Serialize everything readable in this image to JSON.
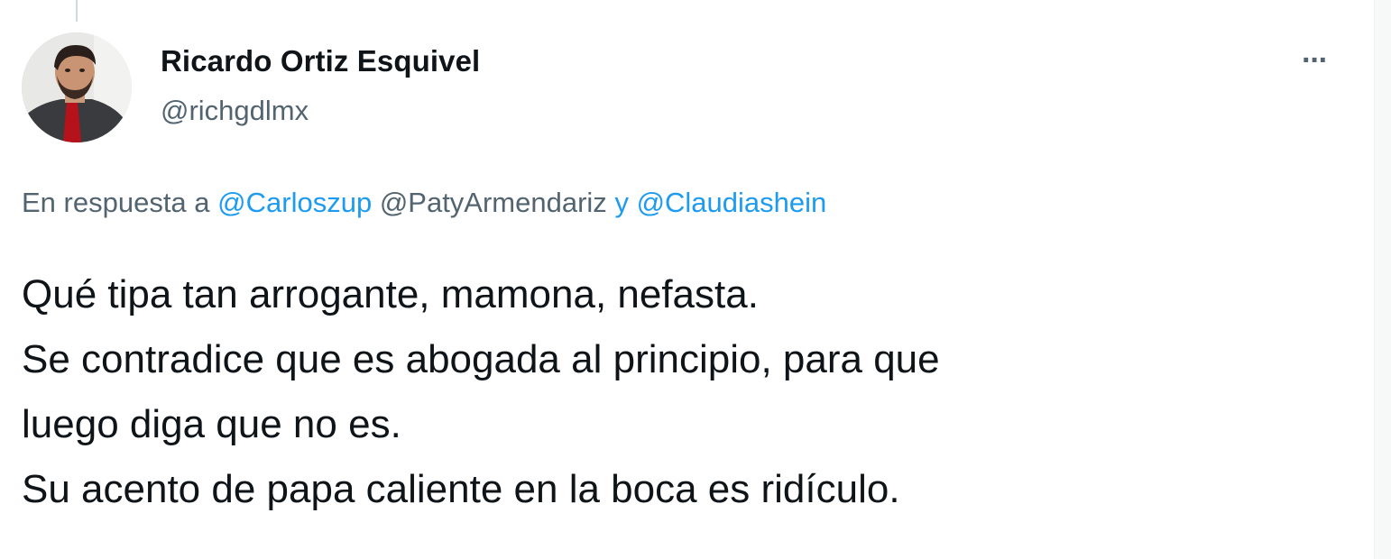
{
  "author": {
    "display_name": "Ricardo Ortiz Esquivel",
    "handle": "@richgdlmx",
    "avatar_icon": "profile-photo"
  },
  "more_icon": "ellipsis-icon",
  "more_label": "···",
  "reply": {
    "prefix": "En respuesta a",
    "mentions": [
      "@Carloszup",
      "@PatyArmendariz",
      "@Claudiashein"
    ],
    "conjunction": "y"
  },
  "tweet": {
    "lines": [
      "Qué tipa tan arrogante, mamona, nefasta.",
      "Se contradice que es abogada al principio, para que",
      "luego diga que no es.",
      "Su acento de papa caliente en la boca es ridículo."
    ]
  },
  "colors": {
    "link": "#1d9bf0",
    "secondary_text": "#536471",
    "primary_text": "#0f1419"
  }
}
